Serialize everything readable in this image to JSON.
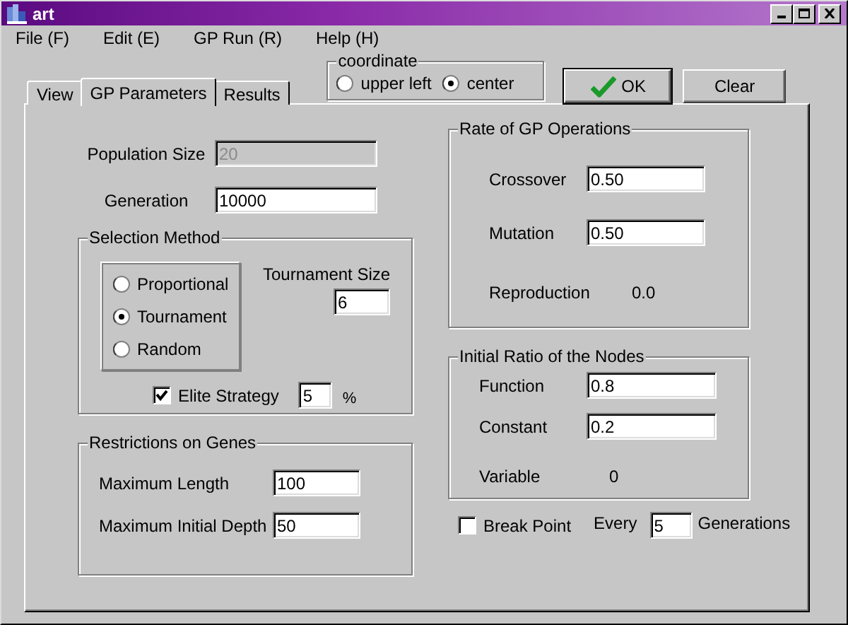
{
  "window": {
    "title": "art"
  },
  "menu": [
    {
      "label": "File (F)"
    },
    {
      "label": "Edit (E)"
    },
    {
      "label": "GP Run (R)"
    },
    {
      "label": "Help (H)"
    }
  ],
  "tabs": [
    {
      "label": "View",
      "selected": false
    },
    {
      "label": "GP Parameters",
      "selected": true
    },
    {
      "label": "Results",
      "selected": false
    }
  ],
  "coordinate": {
    "title": "coordinate",
    "options": [
      {
        "label": "upper left",
        "selected": false
      },
      {
        "label": "center",
        "selected": true
      }
    ]
  },
  "buttons": [
    {
      "label": "OK",
      "kind": "ok"
    },
    {
      "label": "Clear",
      "kind": "plain"
    }
  ],
  "population_size": {
    "label": "Population Size",
    "value": "20",
    "disabled": true
  },
  "generation": {
    "label": "Generation",
    "value": "10000",
    "disabled": false
  },
  "selection_method": {
    "title": "Selection Method",
    "options": [
      {
        "label": "Proportional",
        "selected": false
      },
      {
        "label": "Tournament",
        "selected": true
      },
      {
        "label": "Random",
        "selected": false
      }
    ],
    "tournament_size": {
      "label": "Tournament Size",
      "value": "6"
    },
    "elite_strategy": {
      "label": "Elite Strategy",
      "checked": true,
      "value": "5",
      "unit": "%"
    }
  },
  "restrictions": {
    "title": "Restrictions on Genes",
    "rows": [
      {
        "kind": "input",
        "label": "Maximum Length",
        "value": "100"
      },
      {
        "kind": "input",
        "label": "Maximum Initial Depth",
        "value": "50"
      }
    ]
  },
  "gp_operations": {
    "title": "Rate of GP Operations",
    "rows": [
      {
        "kind": "input",
        "label": "Crossover",
        "value": "0.50"
      },
      {
        "kind": "input",
        "label": "Mutation",
        "value": "0.50"
      },
      {
        "kind": "text",
        "label": "Reproduction",
        "value": "0.0"
      }
    ]
  },
  "initial_ratio": {
    "title": "Initial Ratio of the Nodes",
    "rows": [
      {
        "kind": "input",
        "label": "Function",
        "value": "0.8"
      },
      {
        "kind": "input",
        "label": "Constant",
        "value": "0.2"
      },
      {
        "kind": "text",
        "label": "Variable",
        "value": "0"
      }
    ]
  },
  "break_point": {
    "label": "Break Point",
    "checked": false,
    "every": "Every",
    "value": "5",
    "unit": "Generations"
  }
}
